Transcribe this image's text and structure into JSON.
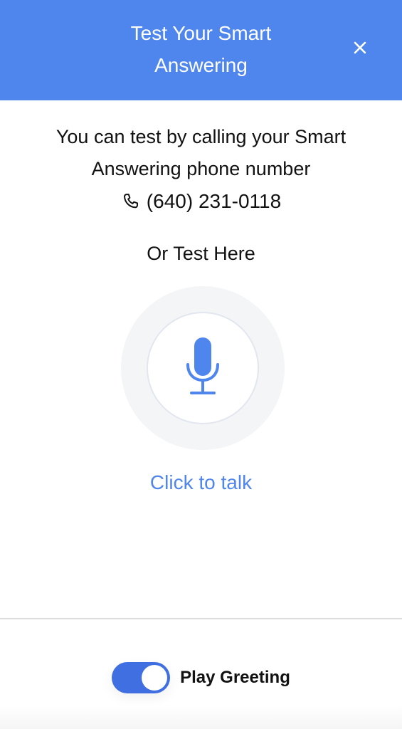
{
  "header": {
    "title": "Test Your Smart Answering",
    "close_icon": "close-icon"
  },
  "intro": {
    "text": "You can test by calling your Smart Answering phone number",
    "phone_icon": "phone-icon",
    "phone_number": "(640) 231-0118"
  },
  "alt_test": {
    "label": "Or Test Here",
    "mic_icon": "microphone-icon",
    "action_label": "Click to talk"
  },
  "footer": {
    "toggle_label": "Play Greeting",
    "toggle_on": true
  },
  "colors": {
    "accent": "#4f86ed",
    "toggle": "#3f6fe0",
    "mic_outer": "#f4f5f7",
    "mic_border": "#e2e6ef"
  }
}
